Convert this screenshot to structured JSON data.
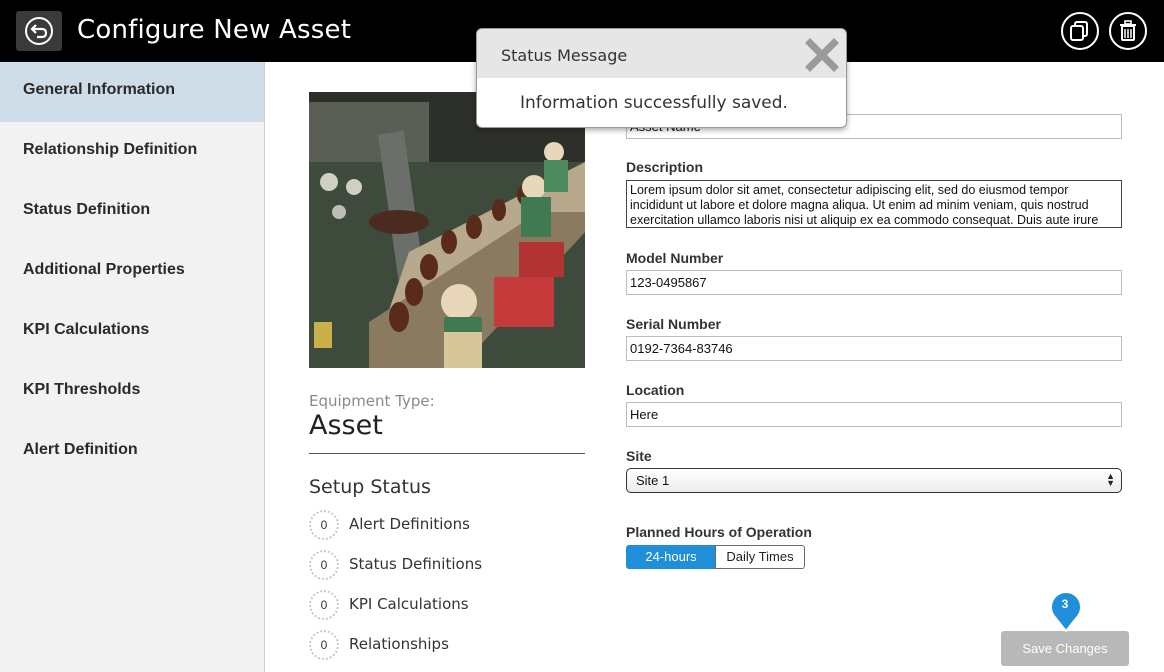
{
  "header": {
    "title": "Configure New Asset",
    "back_icon": "back-arrow-icon",
    "copy_icon": "copy-icon",
    "delete_icon": "trash-icon"
  },
  "sidebar": {
    "items": [
      {
        "label": "General Information",
        "active": true
      },
      {
        "label": "Relationship Definition"
      },
      {
        "label": "Status Definition"
      },
      {
        "label": "Additional Properties"
      },
      {
        "label": "KPI Calculations"
      },
      {
        "label": "KPI Thresholds"
      },
      {
        "label": "Alert Definition"
      }
    ]
  },
  "asset": {
    "equipment_type_label": "Equipment Type:",
    "equipment_type_value": "Asset",
    "setup_status_title": "Setup Status",
    "setup_status": [
      {
        "count": "0",
        "label": "Alert Definitions"
      },
      {
        "count": "0",
        "label": "Status Definitions"
      },
      {
        "count": "0",
        "label": "KPI Calculations"
      },
      {
        "count": "0",
        "label": "Relationships"
      }
    ]
  },
  "form": {
    "name_value": "Asset Name",
    "description_label": "Description",
    "description_value": "Lorem ipsum dolor sit amet, consectetur adipiscing elit, sed do eiusmod tempor incididunt ut labore et dolore magna aliqua. Ut enim ad minim veniam, quis nostrud exercitation ullamco laboris nisi ut aliquip ex ea commodo consequat. Duis aute irure",
    "model_label": "Model Number",
    "model_value": "123-0495867",
    "serial_label": "Serial Number",
    "serial_value": "0192-7364-83746",
    "location_label": "Location",
    "location_value": "Here",
    "site_label": "Site",
    "site_value": "Site 1",
    "hours_label": "Planned Hours of Operation",
    "hours_options": [
      "24-hours",
      "Daily Times"
    ],
    "hours_selected": "24-hours"
  },
  "save": {
    "label": "Save Changes",
    "badge": "3"
  },
  "toast": {
    "title": "Status Message",
    "message": "Information successfully saved.",
    "close_icon": "close-icon"
  },
  "colors": {
    "header_bg": "#000000",
    "sidebar_active": "#cfdde8",
    "accent_blue": "#1e8fd8",
    "save_disabled": "#b8b8b8"
  }
}
